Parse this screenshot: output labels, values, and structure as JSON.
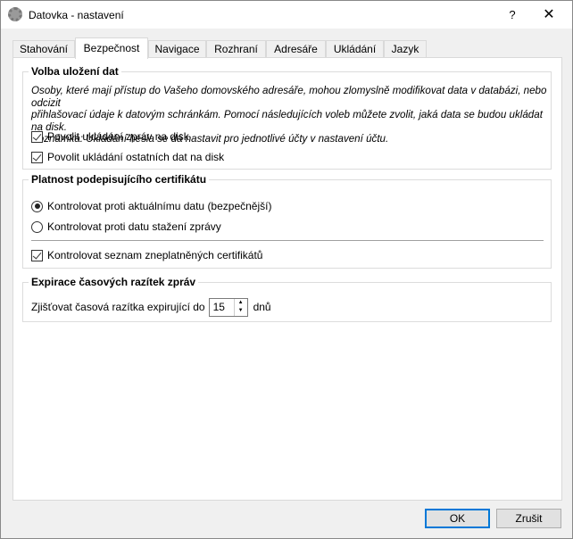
{
  "window": {
    "title": "Datovka - nastavení",
    "help": "?",
    "close": "✕"
  },
  "tabs": [
    "Stahování",
    "Bezpečnost",
    "Navigace",
    "Rozhraní",
    "Adresáře",
    "Ukládání",
    "Jazyk"
  ],
  "storage": {
    "title": "Volba uložení dat",
    "description": [
      "Osoby, které mají přístup do Vašeho domovského adresáře, mohou zlomyslně modifikovat data v databázi, nebo odcizit",
      "přihlašovací údaje k datovým schránkám. Pomocí následujících voleb můžete zvolit, jaká data se budou ukládat na disk.",
      "Poznámka: Ukládání hesla se dá nastavit pro jednotlivé účty v nastavení účtu."
    ],
    "opt_messages": "Povolit ukládání zpráv na disk",
    "opt_other": "Povolit ukládání ostatních dat na disk"
  },
  "cert": {
    "title": "Platnost podepisujícího certifikátu",
    "radio_current": "Kontrolovat proti aktuálnímu datu (bezpečnější)",
    "radio_download": "Kontrolovat proti datu stažení zprávy",
    "crl": "Kontrolovat seznam zneplatněných certifikátů"
  },
  "timestamp": {
    "title": "Expirace časových razítek zpráv",
    "label": "Zjišťovat časová razítka expirující do",
    "value": "15",
    "unit": "dnů"
  },
  "buttons": {
    "ok": "OK",
    "cancel": "Zrušit"
  }
}
